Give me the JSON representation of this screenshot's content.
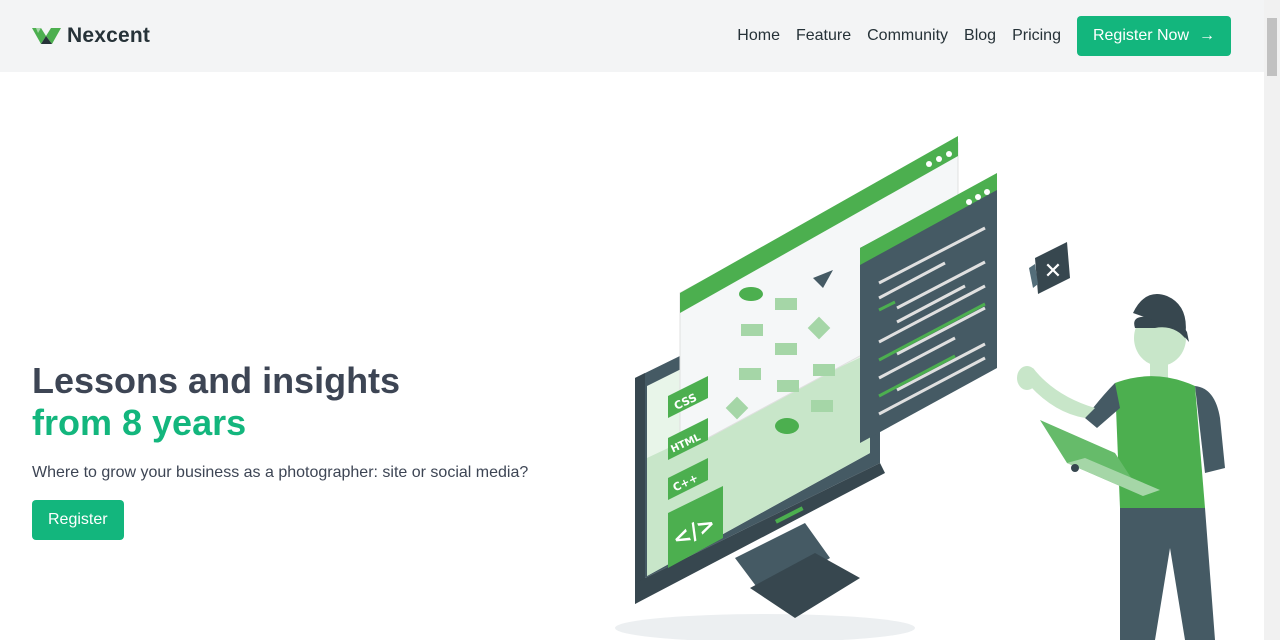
{
  "brand": {
    "name": "Nexcent"
  },
  "nav": {
    "items": [
      "Home",
      "Feature",
      "Community",
      "Blog",
      "Pricing"
    ],
    "cta_label": "Register Now",
    "cta_icon": "arrow-right-icon"
  },
  "hero": {
    "title_line1": "Lessons and insights",
    "title_line2": "from 8 years",
    "subtitle": "Where to grow your business as a photographer: site or social media?",
    "button_label": "Register"
  },
  "illustration": {
    "code_badges": [
      "CSS",
      "HTML",
      "C++"
    ],
    "tag_symbol": "</>"
  },
  "colors": {
    "brand": "#13b67d",
    "green_illus": "#4caf4f",
    "dark": "#263238",
    "header_bg": "#f3f4f5"
  }
}
